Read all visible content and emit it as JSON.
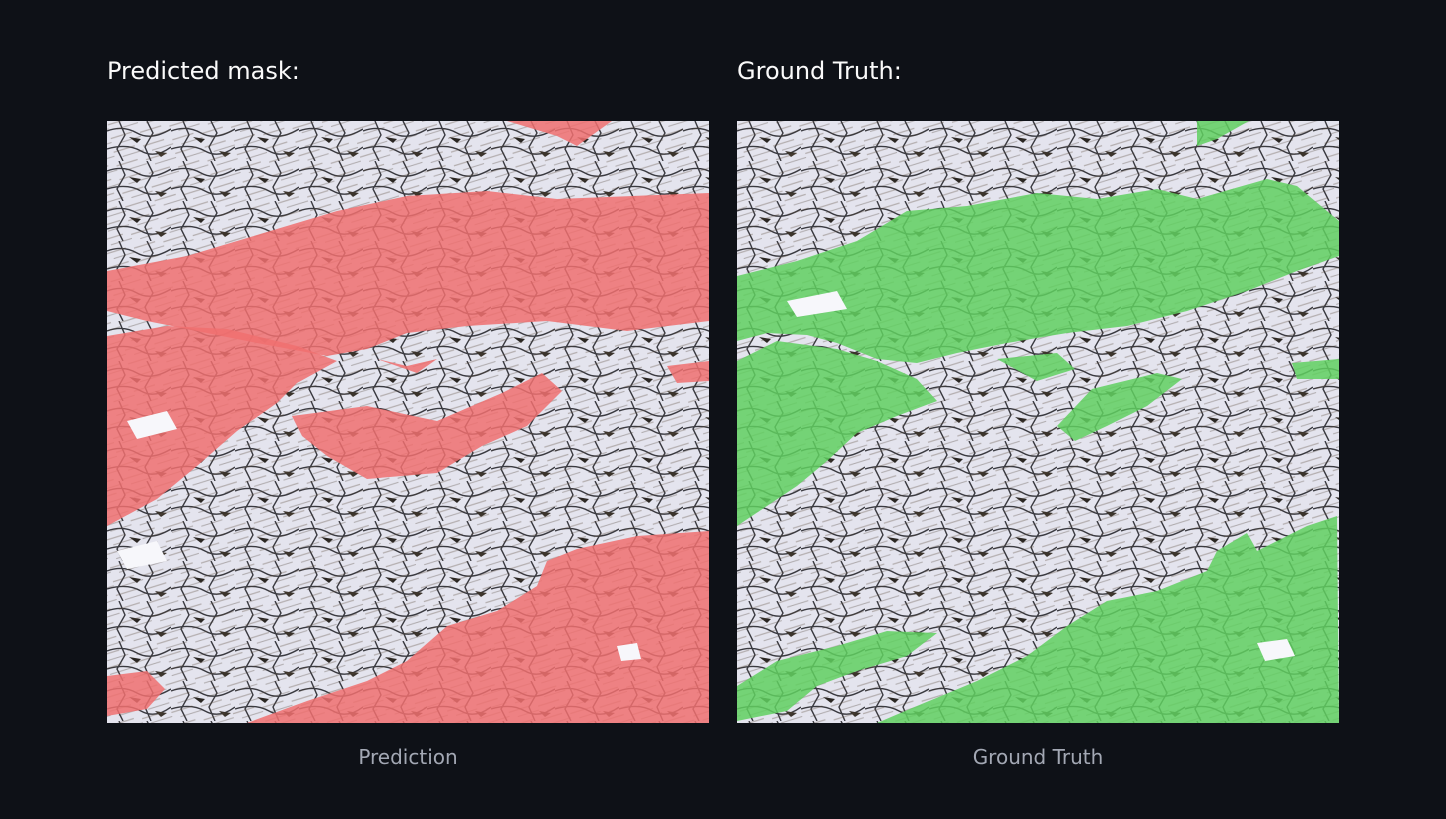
{
  "panels": [
    {
      "heading": "Predicted mask:",
      "caption": "Prediction",
      "overlay_color": "#f07070",
      "image_content": "micrograph-with-mask-overlay"
    },
    {
      "heading": "Ground Truth:",
      "caption": "Ground Truth",
      "overlay_color": "#60d060",
      "image_content": "micrograph-with-mask-overlay"
    }
  ],
  "colors": {
    "background": "#0e1117",
    "heading_text": "#fafafa",
    "caption_text": "#a3a8b4"
  }
}
